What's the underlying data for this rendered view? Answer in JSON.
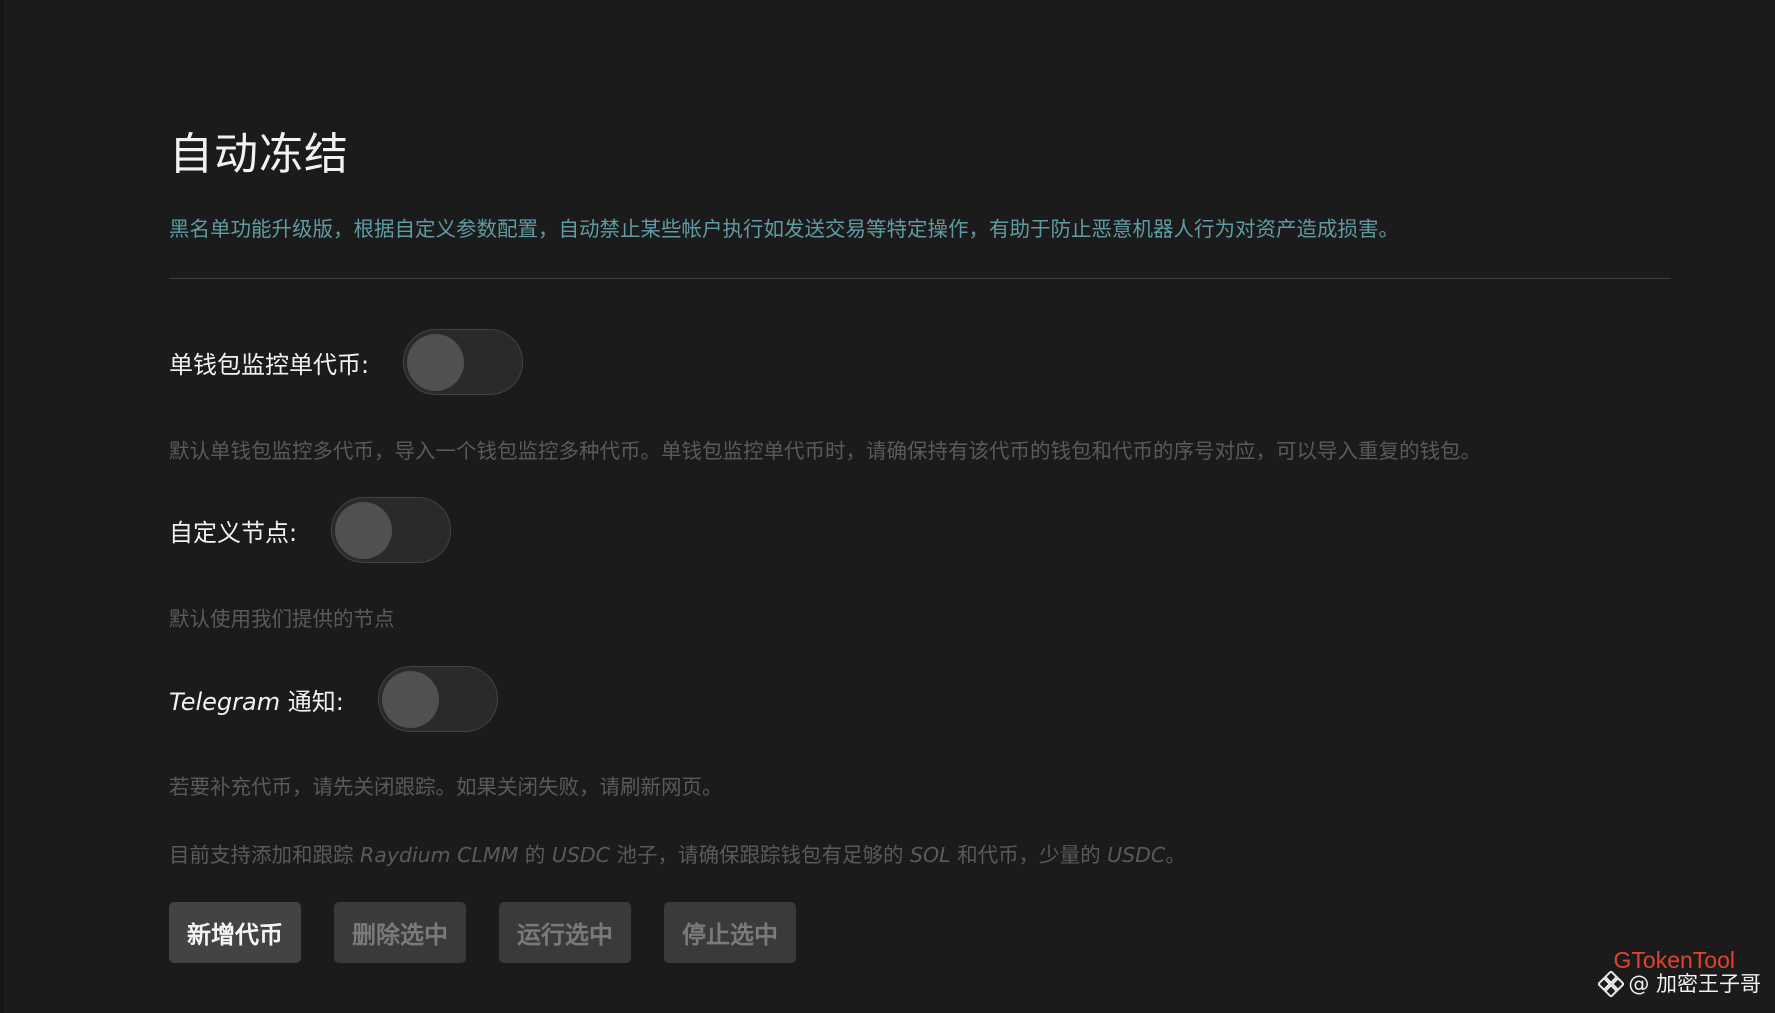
{
  "header": {
    "title": "自动冻结",
    "description": "黑名单功能升级版，根据自定义参数配置，自动禁止某些帐户执行如发送交易等特定操作，有助于防止恶意机器人行为对资产造成损害。"
  },
  "settings": [
    {
      "label": "单钱包监控单代币:",
      "enabled": false,
      "hint": "默认单钱包监控多代币，导入一个钱包监控多种代币。单钱包监控单代币时，请确保持有该代币的钱包和代币的序号对应，可以导入重复的钱包。"
    },
    {
      "label": "自定义节点:",
      "enabled": false,
      "hint": "默认使用我们提供的节点"
    },
    {
      "label_en": "Telegram",
      "label_zh": " 通知:",
      "enabled": false,
      "hint": "若要补充代币，请先关闭跟踪。如果关闭失败，请刷新网页。"
    }
  ],
  "support_note": {
    "prefix": "目前支持添加和跟踪 ",
    "dex": "Raydium CLMM",
    "mid1": " 的 ",
    "pool_token": "USDC",
    "mid2": " 池子，请确保跟踪钱包有足够的 ",
    "gas_token": "SOL",
    "mid3": " 和代币，少量的 ",
    "small_token": "USDC",
    "suffix": "。"
  },
  "actions": {
    "add_token": "新增代币",
    "delete_selected": "删除选中",
    "run_selected": "运行选中",
    "stop_selected": "停止选中"
  },
  "watermark": {
    "brand": "GTokenTool",
    "author": "@ 加密王子哥"
  },
  "colors": {
    "background": "#1b1b1b",
    "description_text": "#5f9ba3",
    "hint_text": "#5a5a5a",
    "watermark_brand": "#e0442f"
  }
}
